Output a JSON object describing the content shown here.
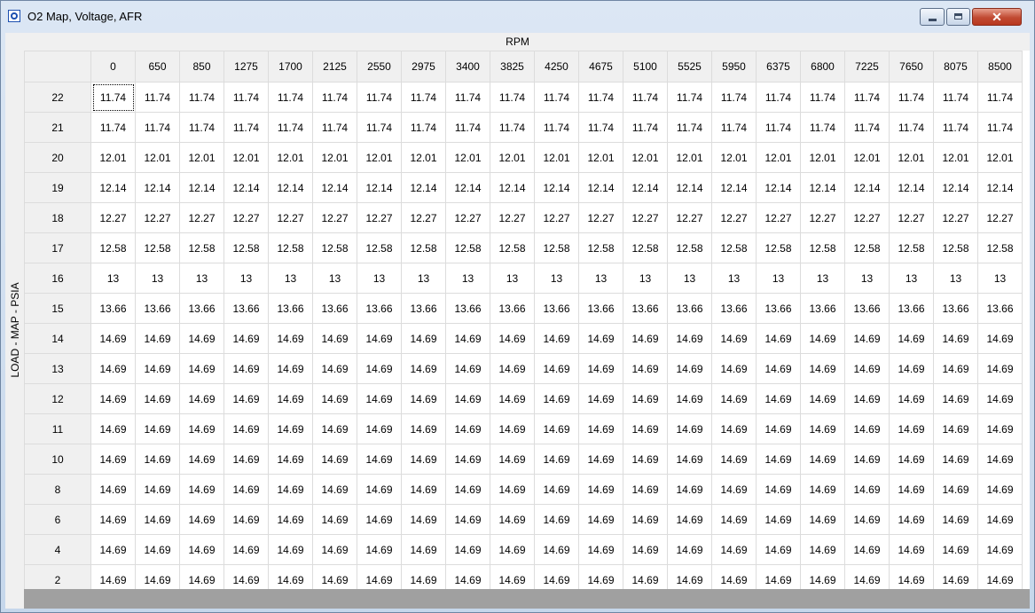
{
  "window": {
    "title": "O2 Map, Voltage, AFR"
  },
  "axes": {
    "x_label": "RPM",
    "y_label": "LOAD - MAP - PSIA"
  },
  "columns": [
    "0",
    "650",
    "850",
    "1275",
    "1700",
    "2125",
    "2550",
    "2975",
    "3400",
    "3825",
    "4250",
    "4675",
    "5100",
    "5525",
    "5950",
    "6375",
    "6800",
    "7225",
    "7650",
    "8075",
    "8500"
  ],
  "rows": [
    {
      "load": "22",
      "value": "11.74"
    },
    {
      "load": "21",
      "value": "11.74"
    },
    {
      "load": "20",
      "value": "12.01"
    },
    {
      "load": "19",
      "value": "12.14"
    },
    {
      "load": "18",
      "value": "12.27"
    },
    {
      "load": "17",
      "value": "12.58"
    },
    {
      "load": "16",
      "value": "13"
    },
    {
      "load": "15",
      "value": "13.66"
    },
    {
      "load": "14",
      "value": "14.69"
    },
    {
      "load": "13",
      "value": "14.69"
    },
    {
      "load": "12",
      "value": "14.69"
    },
    {
      "load": "11",
      "value": "14.69"
    },
    {
      "load": "10",
      "value": "14.69"
    },
    {
      "load": "8",
      "value": "14.69"
    },
    {
      "load": "6",
      "value": "14.69"
    },
    {
      "load": "4",
      "value": "14.69"
    },
    {
      "load": "2",
      "value": "14.69"
    }
  ],
  "selected_cell": {
    "row": 0,
    "col": 0
  }
}
